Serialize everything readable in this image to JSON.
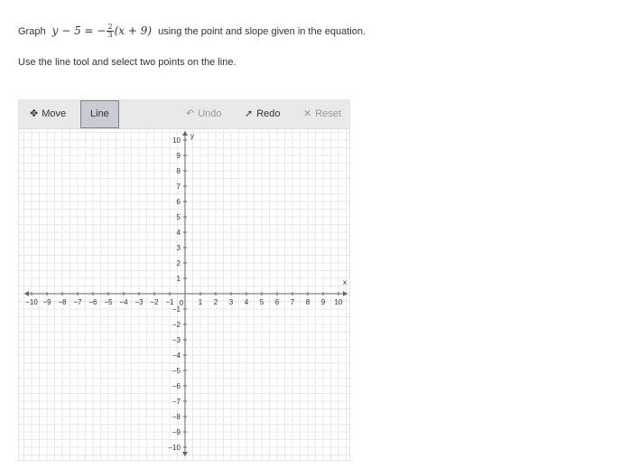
{
  "question": {
    "prefix": "Graph",
    "eq_lhs": "y − 5 = −",
    "eq_num": "2",
    "eq_den": "3",
    "eq_rhs": "(x + 9)",
    "suffix": "using the point and slope given in the equation.",
    "instruction": "Use the line tool and select two points on the line."
  },
  "toolbar": {
    "move_label": "Move",
    "line_label": "Line",
    "undo_label": "Undo",
    "redo_label": "Redo",
    "reset_label": "Reset",
    "selected_tool": "Line",
    "undo_enabled": false,
    "reset_enabled": false
  },
  "graph": {
    "x_axis_label": "x",
    "y_axis_label": "y",
    "x_range": [
      -10,
      10
    ],
    "y_range": [
      -10,
      10
    ],
    "tick_step": 1,
    "minor_grid_step": 0.5,
    "origin_label": "0",
    "x_tick_labels": [
      "−10",
      "−9",
      "−8",
      "−7",
      "−6",
      "−5",
      "−4",
      "−3",
      "−2",
      "−1",
      "1",
      "2",
      "3",
      "4",
      "5",
      "6",
      "7",
      "8",
      "9",
      "10"
    ],
    "y_tick_labels": [
      "10",
      "9",
      "8",
      "7",
      "6",
      "5",
      "4",
      "3",
      "2",
      "1",
      "−1",
      "−2",
      "−3",
      "−4",
      "−5",
      "−6",
      "−7",
      "−8",
      "−9",
      "−10"
    ],
    "colors": {
      "grid": "#e8e8e8",
      "axis": "#666666",
      "selected_border": "#4a90d9"
    }
  }
}
